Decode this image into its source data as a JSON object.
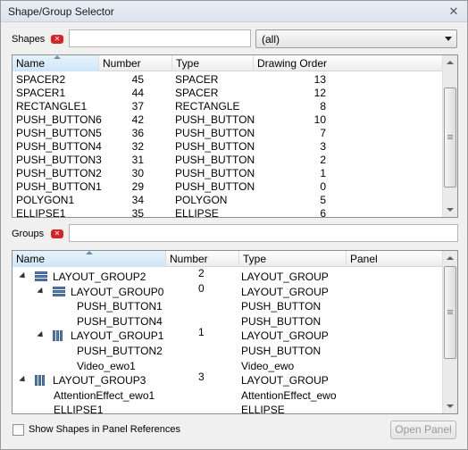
{
  "window": {
    "title": "Shape/Group Selector",
    "close_glyph": "✕"
  },
  "shapes": {
    "label": "Shapes",
    "filter_value": "",
    "type_select": "(all)",
    "columns": [
      "Name",
      "Number",
      "Type",
      "Drawing Order"
    ],
    "rows": [
      {
        "name": "SPACER2",
        "number": "45",
        "type": "SPACER",
        "order": "13"
      },
      {
        "name": "SPACER1",
        "number": "44",
        "type": "SPACER",
        "order": "12"
      },
      {
        "name": "RECTANGLE1",
        "number": "37",
        "type": "RECTANGLE",
        "order": "8"
      },
      {
        "name": "PUSH_BUTTON6",
        "number": "42",
        "type": "PUSH_BUTTON",
        "order": "10"
      },
      {
        "name": "PUSH_BUTTON5",
        "number": "36",
        "type": "PUSH_BUTTON",
        "order": "7"
      },
      {
        "name": "PUSH_BUTTON4",
        "number": "32",
        "type": "PUSH_BUTTON",
        "order": "3"
      },
      {
        "name": "PUSH_BUTTON3",
        "number": "31",
        "type": "PUSH_BUTTON",
        "order": "2"
      },
      {
        "name": "PUSH_BUTTON2",
        "number": "30",
        "type": "PUSH_BUTTON",
        "order": "1"
      },
      {
        "name": "PUSH_BUTTON1",
        "number": "29",
        "type": "PUSH_BUTTON",
        "order": "0"
      },
      {
        "name": "POLYGON1",
        "number": "34",
        "type": "POLYGON",
        "order": "5"
      },
      {
        "name": "ELLIPSE1",
        "number": "35",
        "type": "ELLIPSE",
        "order": "6"
      }
    ]
  },
  "groups": {
    "label": "Groups",
    "filter_value": "",
    "columns": [
      "Name",
      "Number",
      "Type",
      "Panel"
    ],
    "rows": [
      {
        "name": "LAYOUT_GROUP2",
        "number": "2",
        "type": "LAYOUT_GROUP",
        "icon": "layout-vertical-icon"
      },
      {
        "name": "LAYOUT_GROUP0",
        "number": "0",
        "type": "LAYOUT_GROUP",
        "icon": "layout-vertical-icon"
      },
      {
        "name": "PUSH_BUTTON1",
        "number": "",
        "type": "PUSH_BUTTON"
      },
      {
        "name": "PUSH_BUTTON4",
        "number": "",
        "type": "PUSH_BUTTON"
      },
      {
        "name": "LAYOUT_GROUP1",
        "number": "1",
        "type": "LAYOUT_GROUP",
        "icon": "layout-horizontal-icon"
      },
      {
        "name": "PUSH_BUTTON2",
        "number": "",
        "type": "PUSH_BUTTON"
      },
      {
        "name": "Video_ewo1",
        "number": "",
        "type": "Video_ewo"
      },
      {
        "name": "LAYOUT_GROUP3",
        "number": "3",
        "type": "LAYOUT_GROUP",
        "icon": "layout-horizontal-icon"
      },
      {
        "name": "AttentionEffect_ewo1",
        "number": "",
        "type": "AttentionEffect_ewo"
      },
      {
        "name": "ELLIPSE1",
        "number": "",
        "type": "ELLIPSE"
      }
    ]
  },
  "footer": {
    "checkbox_label": "Show Shapes in Panel References",
    "checkbox_checked": false,
    "open_panel_label": "Open Panel",
    "open_panel_enabled": false
  }
}
